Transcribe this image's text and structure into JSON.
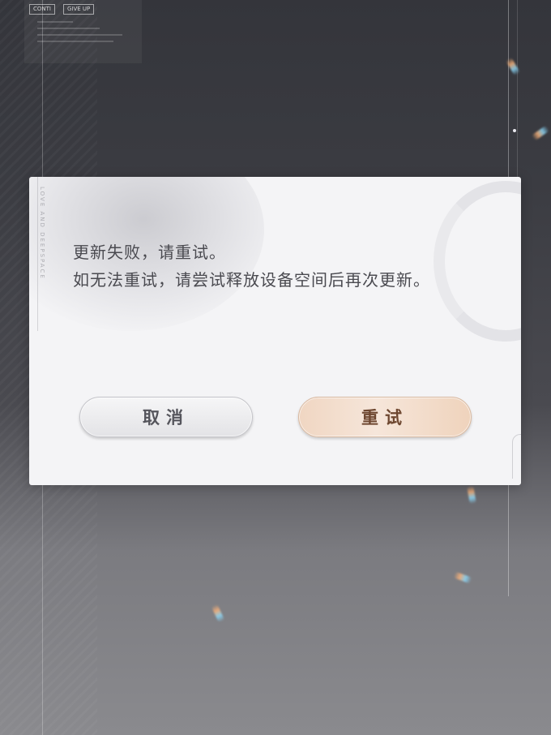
{
  "hud": {
    "continue_label": "CONTI",
    "give_up_label": "GIVE UP"
  },
  "dialog": {
    "side_text": "LOVE AND DEEPSPACE",
    "message_line1": "更新失败，请重试。",
    "message_line2": "如无法重试，请尝试释放设备空间后再次更新。",
    "cancel_label": "取消",
    "retry_label": "重试"
  },
  "colors": {
    "dialog_bg": "#f4f4f6",
    "message_text": "#4a4a50",
    "retry_accent": "#f0d6c2",
    "retry_text": "#6e4730"
  }
}
